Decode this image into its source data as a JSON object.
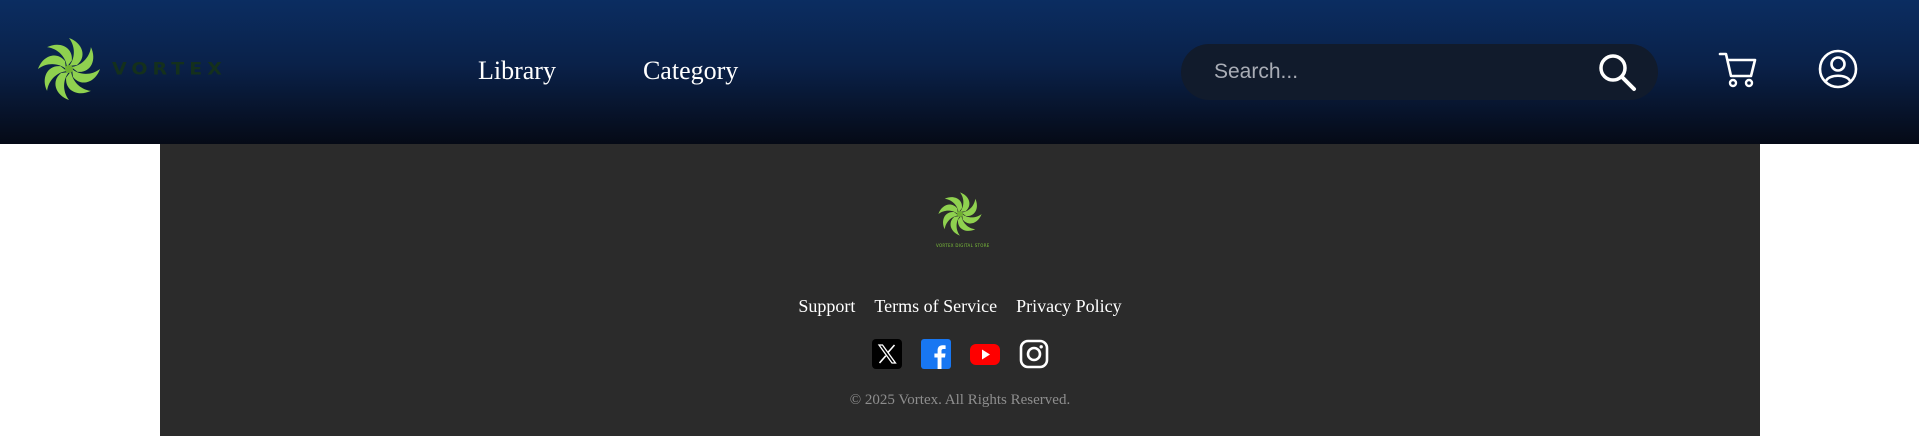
{
  "header": {
    "brand_name": "VORTEX",
    "nav": [
      {
        "label": "Library"
      },
      {
        "label": "Category"
      }
    ],
    "search": {
      "placeholder": "Search...",
      "icon": "search-icon"
    },
    "cart_icon": "cart-icon",
    "user_icon": "user-icon"
  },
  "footer": {
    "logo_text": "VORTEX DIGITAL STORE",
    "links": [
      {
        "label": "Support"
      },
      {
        "label": "Terms of Service"
      },
      {
        "label": "Privacy Policy"
      }
    ],
    "socials": [
      {
        "name": "x-icon"
      },
      {
        "name": "facebook-icon"
      },
      {
        "name": "youtube-icon"
      },
      {
        "name": "instagram-icon"
      }
    ],
    "copyright": "© 2025 Vortex. All Rights Reserved."
  },
  "colors": {
    "header_top": "#0b2d61",
    "header_bottom": "#050a16",
    "footer_bg": "#2b2b2b",
    "logo_green": "#8fd14f",
    "youtube_red": "#ff0000",
    "facebook_blue": "#1877f2"
  }
}
